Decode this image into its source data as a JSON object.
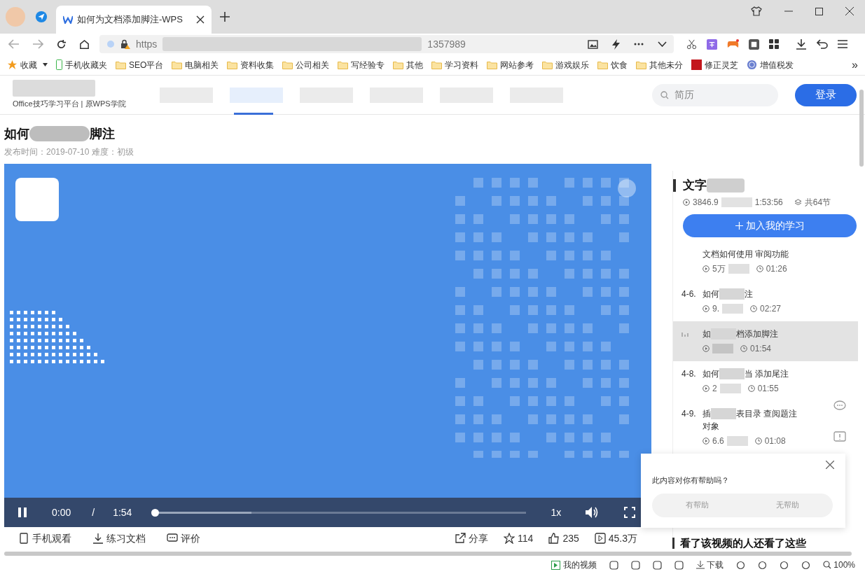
{
  "browser": {
    "tabs": [
      {
        "title": "如何为文档添加脚注-WPS",
        "selected": true
      }
    ],
    "url_start": "https",
    "url_end": "1357989",
    "bookmarks": [
      {
        "label": "收藏",
        "kind": "star"
      },
      {
        "label": "手机收藏夹",
        "kind": "phone"
      },
      {
        "label": "SEO平台",
        "kind": "folder"
      },
      {
        "label": "电脑相关",
        "kind": "folder"
      },
      {
        "label": "资料收集",
        "kind": "folder"
      },
      {
        "label": "公司相关",
        "kind": "folder"
      },
      {
        "label": "写经验专",
        "kind": "folder"
      },
      {
        "label": "其他",
        "kind": "folder"
      },
      {
        "label": "学习资料",
        "kind": "folder"
      },
      {
        "label": "网站参考",
        "kind": "folder"
      },
      {
        "label": "游戏娱乐",
        "kind": "folder"
      },
      {
        "label": "饮食",
        "kind": "folder"
      },
      {
        "label": "其他未分",
        "kind": "folder"
      },
      {
        "label": "修正灵芝",
        "kind": "jd"
      },
      {
        "label": "增值税发",
        "kind": "globe"
      }
    ],
    "more": "»"
  },
  "site": {
    "logo_subtitle": "Office技巧学习平台 | 原WPS学院",
    "nav": [
      {
        "selected": false
      },
      {
        "selected": true
      },
      {
        "selected": false
      },
      {
        "selected": false
      },
      {
        "selected": false
      },
      {
        "selected": false
      }
    ],
    "search": {
      "placeholder": "简历"
    },
    "login": "登录"
  },
  "article": {
    "title_start": "如何",
    "title_end": "脚注",
    "meta": "发布时间：2019-07-10 难度：初级"
  },
  "player": {
    "playing": true,
    "time": "0:00",
    "separator": "/",
    "duration": "1:54",
    "speed": "1x",
    "level": 0.0,
    "buffer": {
      "level": 0.26
    }
  },
  "actions": [
    {
      "label": "手机观看",
      "kind": "phone"
    },
    {
      "label": "练习文档",
      "kind": "download"
    },
    {
      "label": "评价",
      "kind": "comment"
    },
    {
      "label": "分享",
      "kind": "share"
    },
    {
      "label": "114",
      "kind": "star"
    },
    {
      "label": "235",
      "kind": "like"
    },
    {
      "label": "45.3万",
      "kind": "play"
    }
  ],
  "course": {
    "title": "文字",
    "views": "3846.9",
    "total_time": "1:53:56",
    "lessons_count": "共64节",
    "join": "加入我的学习",
    "lessons": [
      {
        "title_start": "文档如何使用 审阅功能",
        "views": "5万",
        "duration": "01:26",
        "selected": false
      },
      {
        "number": "4-6.",
        "title_start": "如何",
        "title_end": "注",
        "views": "9.",
        "duration": "02:27",
        "selected": false
      },
      {
        "title_start": "如",
        "title_end": "档添加脚注",
        "duration": "01:54",
        "selected": true
      },
      {
        "number": "4-8.",
        "title_start": "如何",
        "title_end": "当 添加尾注",
        "views": "2",
        "duration": "01:55",
        "selected": false
      },
      {
        "number": "4-9.",
        "title_start": "插",
        "title_end": "表目录 查阅题注",
        "title_line2": "对象",
        "views": "6.6",
        "duration": "01:08",
        "selected": false
      }
    ]
  },
  "feedback": {
    "question": "此内容对你有帮助吗？",
    "yes": "有帮助",
    "no": "无帮助"
  },
  "related_heading": "看了该视频的人还看了这些",
  "status_bar": {
    "my_videos": "我的视频",
    "download": "下载",
    "zoom": "100%"
  }
}
